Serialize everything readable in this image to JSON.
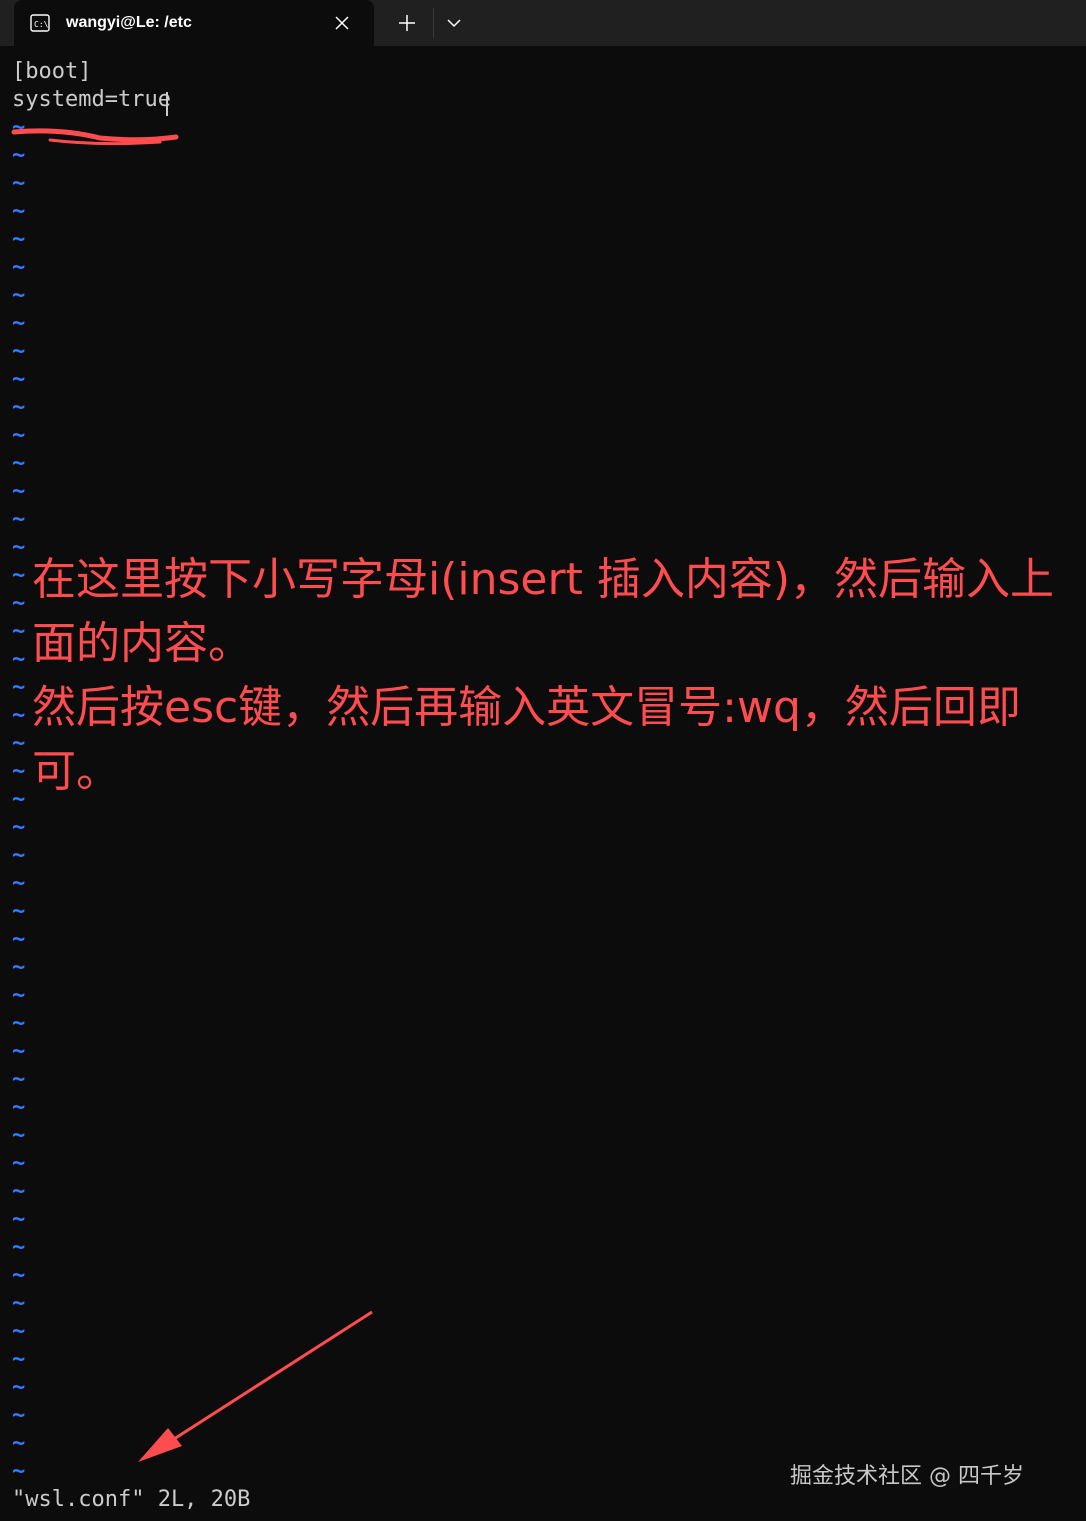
{
  "tab": {
    "title": "wangyi@Le: /etc",
    "icon": "terminal-icon"
  },
  "editor": {
    "lines": [
      "[boot]",
      "systemd=true"
    ],
    "empty_line_marker": "~",
    "status_line": "\"wsl.conf\" 2L, 20B"
  },
  "annotation": {
    "line1": "在这里按下小写字母i(insert 插入内容)，然后输入上面的内容。",
    "line2": "然后按esc键，然后再输入英文冒号:wq，然后回即可。"
  },
  "watermark": "掘金技术社区 @ 四千岁",
  "colors": {
    "background": "#0c0c0c",
    "titlebar": "#202020",
    "text": "#cccccc",
    "tilde": "#3b78ff",
    "annotation": "#ff4d4f"
  }
}
